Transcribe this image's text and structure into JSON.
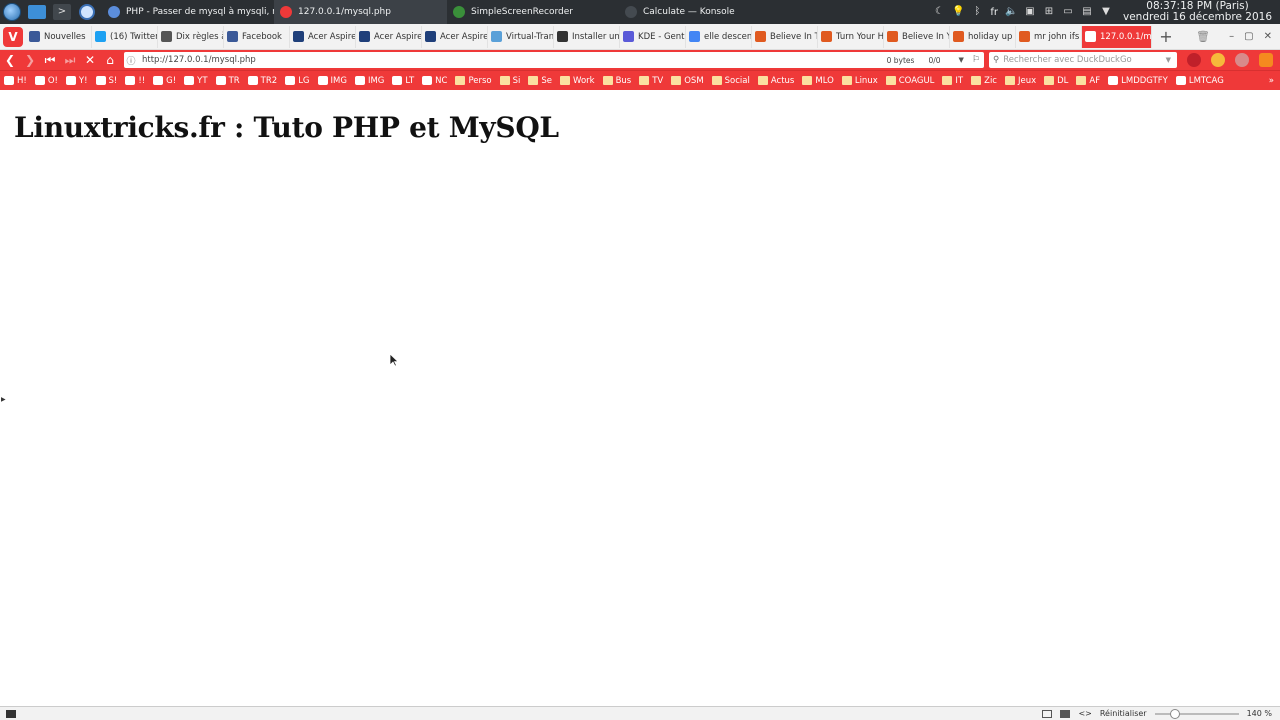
{
  "taskbar": {
    "tasks": [
      {
        "label": "PHP - Passer de mysql à mysqli, req...",
        "color": "#5b8ddb"
      },
      {
        "label": "127.0.0.1/mysql.php",
        "color": "#ef3939"
      },
      {
        "label": "SimpleScreenRecorder",
        "color": "#3a8f3a"
      },
      {
        "label": "Calculate — Konsole",
        "color": "#444a50"
      }
    ],
    "tray": {
      "language": "fr",
      "clock_time": "08:37:18 PM (Paris)",
      "clock_date": "vendredi 16 décembre 2016"
    }
  },
  "tabs": [
    {
      "label": "Nouvelles",
      "color": "#3b5998"
    },
    {
      "label": "(16) Twitter",
      "color": "#1da1f2"
    },
    {
      "label": "Dix règles à",
      "color": "#555555"
    },
    {
      "label": "Facebook",
      "color": "#3b5998"
    },
    {
      "label": "Acer Aspire",
      "color": "#1f3f7a"
    },
    {
      "label": "Acer Aspire",
      "color": "#1f3f7a"
    },
    {
      "label": "Acer Aspire",
      "color": "#1f3f7a"
    },
    {
      "label": "Virtual-Tran",
      "color": "#5aa0d8"
    },
    {
      "label": "Installer un",
      "color": "#333333"
    },
    {
      "label": "KDE - Gent",
      "color": "#5a5ad8"
    },
    {
      "label": "elle descen",
      "color": "#4285f4"
    },
    {
      "label": "Believe In T",
      "color": "#e05a20"
    },
    {
      "label": "Turn Your H",
      "color": "#e05a20"
    },
    {
      "label": "Believe In Y",
      "color": "#e05a20"
    },
    {
      "label": "holiday up i",
      "color": "#e05a20"
    },
    {
      "label": "mr john ifs i",
      "color": "#e05a20"
    },
    {
      "label": "127.0.0.1/m",
      "color": "#ffffff",
      "active": true
    }
  ],
  "address_bar": {
    "url": "http://127.0.0.1/mysql.php",
    "bytes": "0 bytes",
    "counter": "0/0",
    "search_placeholder": "Rechercher avec DuckDuckGo"
  },
  "bookmarks": [
    {
      "label": "H!",
      "kind": "fav"
    },
    {
      "label": "O!",
      "kind": "fav"
    },
    {
      "label": "Y!",
      "kind": "fav"
    },
    {
      "label": "S!",
      "kind": "fav"
    },
    {
      "label": "!!",
      "kind": "fav"
    },
    {
      "label": "G!",
      "kind": "fav"
    },
    {
      "label": "YT",
      "kind": "fav"
    },
    {
      "label": "TR",
      "kind": "fav"
    },
    {
      "label": "TR2",
      "kind": "fav"
    },
    {
      "label": "LG",
      "kind": "fav"
    },
    {
      "label": "IMG",
      "kind": "fav"
    },
    {
      "label": "IMG",
      "kind": "fav"
    },
    {
      "label": "LT",
      "kind": "fav"
    },
    {
      "label": "NC",
      "kind": "fav"
    },
    {
      "label": "Perso",
      "kind": "folder"
    },
    {
      "label": "Si",
      "kind": "folder"
    },
    {
      "label": "Se",
      "kind": "folder"
    },
    {
      "label": "Work",
      "kind": "folder"
    },
    {
      "label": "Bus",
      "kind": "folder"
    },
    {
      "label": "TV",
      "kind": "folder"
    },
    {
      "label": "OSM",
      "kind": "folder"
    },
    {
      "label": "Social",
      "kind": "folder"
    },
    {
      "label": "Actus",
      "kind": "folder"
    },
    {
      "label": "MLO",
      "kind": "folder"
    },
    {
      "label": "Linux",
      "kind": "folder"
    },
    {
      "label": "COAGUL",
      "kind": "folder"
    },
    {
      "label": "IT",
      "kind": "folder"
    },
    {
      "label": "Zic",
      "kind": "folder"
    },
    {
      "label": "Jeux",
      "kind": "folder"
    },
    {
      "label": "DL",
      "kind": "folder"
    },
    {
      "label": "AF",
      "kind": "folder"
    },
    {
      "label": "LMDDGTFY",
      "kind": "fav"
    },
    {
      "label": "LMTCAG",
      "kind": "fav"
    }
  ],
  "page": {
    "heading": "Linuxtricks.fr : Tuto PHP et MySQL"
  },
  "status_bar": {
    "reset_label": "Réinitialiser",
    "zoom": "140 %",
    "zoom_level": 1.4
  },
  "colors": {
    "brand": "#ef3939",
    "taskbar": "#2b2f33"
  }
}
